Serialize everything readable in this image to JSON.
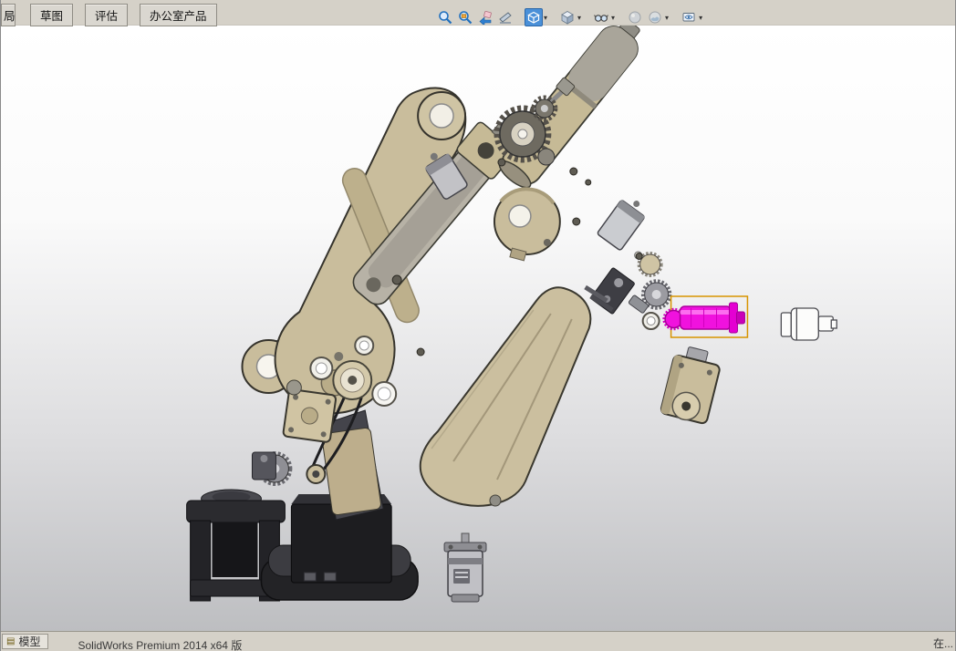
{
  "command_bar": {
    "partial_tab": "局",
    "tabs": [
      {
        "label": "草图"
      },
      {
        "label": "评估"
      },
      {
        "label": "办公室产品"
      }
    ]
  },
  "hud_toolbar": {
    "icons": [
      {
        "name": "zoom-to-fit-icon"
      },
      {
        "name": "zoom-to-area-icon"
      },
      {
        "name": "previous-view-icon"
      },
      {
        "name": "section-view-icon"
      },
      {
        "name": "view-orientation-icon",
        "active": true,
        "dropdown": true
      },
      {
        "name": "display-style-icon",
        "dropdown": true
      },
      {
        "name": "hide-show-items-icon",
        "dropdown": true
      },
      {
        "name": "edit-appearance-icon"
      },
      {
        "name": "apply-scene-icon",
        "dropdown": true
      },
      {
        "name": "view-settings-icon",
        "dropdown": true
      }
    ]
  },
  "status_bar": {
    "model_tab": "模型",
    "app_version": "SolidWorks Premium 2014 x64 版",
    "right_text": "在..."
  },
  "colors": {
    "selection_highlight": "#f012de",
    "selection_box": "#d79400",
    "hud_active": "#4a90d8",
    "model_tan": "#c9bd9c",
    "viewport_top": "#ffffff",
    "viewport_bottom": "#bdbec1"
  }
}
